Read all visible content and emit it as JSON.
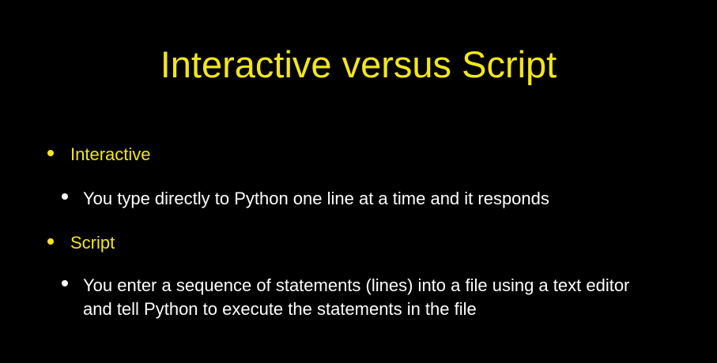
{
  "slide": {
    "title": "Interactive versus Script",
    "colors": {
      "background": "#000000",
      "title_and_level1": "#f2e61a",
      "level2_text": "#ffffff"
    },
    "bullets": [
      {
        "label": "Interactive",
        "detail": "You type directly to Python one line at a time and it responds"
      },
      {
        "label": "Script",
        "detail": "You enter a sequence of statements (lines) into a file using a text editor and tell Python to execute the statements in the file"
      }
    ]
  }
}
